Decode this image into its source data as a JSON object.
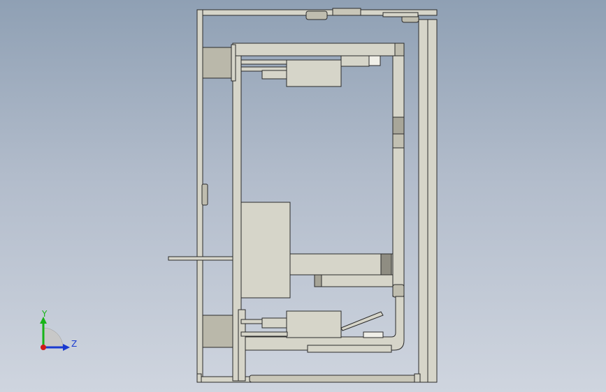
{
  "triad": {
    "y_label": "Y",
    "z_label": "Z",
    "y_color": "#18b418",
    "z_color": "#1a3ad0",
    "x_color": "#d01818"
  },
  "model": {
    "part_color": "#d6d5c9",
    "part_dark": "#bfbdaf",
    "edge_color": "#2a2a2a"
  }
}
